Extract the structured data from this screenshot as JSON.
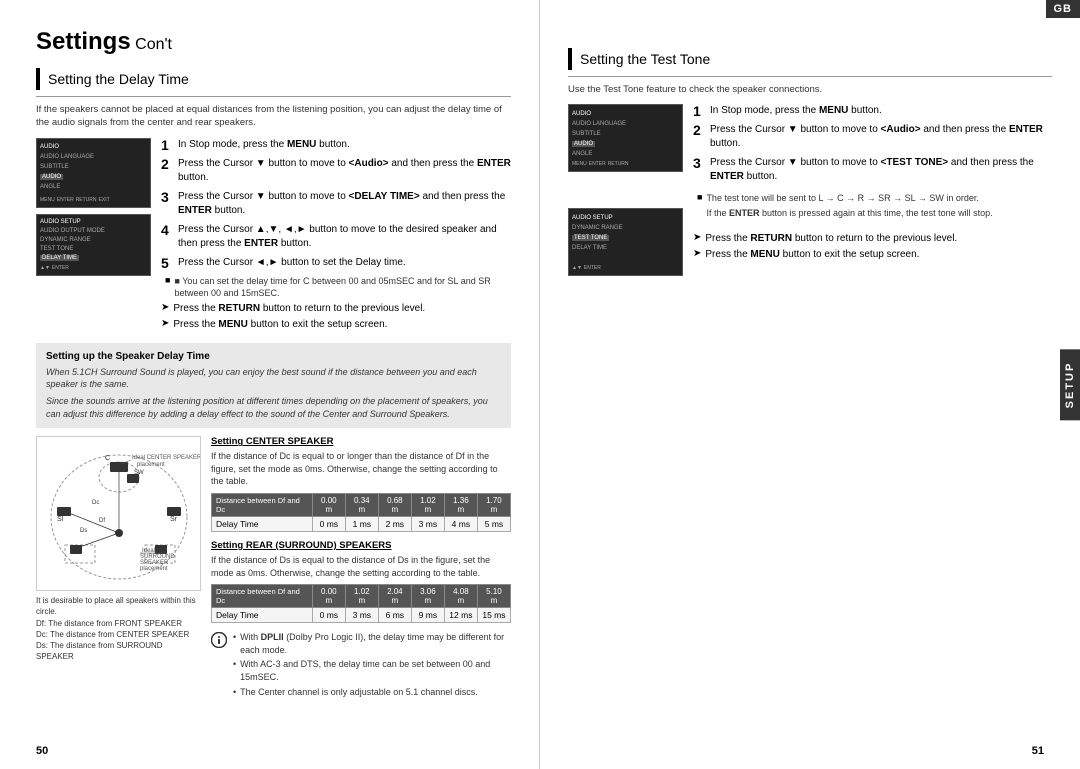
{
  "left": {
    "title": "Settings",
    "title_suffix": " Con't",
    "section1": {
      "heading": "Setting the Delay Time",
      "intro": "If the speakers cannot be placed at equal distances from the listening position, you can adjust the delay time of the audio signals from the center and rear speakers.",
      "steps": [
        {
          "num": "1",
          "text": "In Stop mode, press the MENU button."
        },
        {
          "num": "2",
          "text": "Press the Cursor ▼ button to move to <Audio> and then press the ENTER button."
        },
        {
          "num": "3",
          "text": "Press the Cursor ▼ button to move to <DELAY TIME> and then press the ENTER button."
        },
        {
          "num": "4",
          "text": "Press the Cursor ▲,▼, ◄,► button to move to the desired speaker and then press the ENTER button."
        },
        {
          "num": "5",
          "text": "Press the Cursor ◄,► button to set the Delay time."
        }
      ],
      "note": "■ You can set the delay time for C between 00 and 05mSEC and for SL and SR between 00 and 15mSEC.",
      "return_text": "Press the RETURN button to return to the previous level.",
      "menu_text": "Press the MENU button to exit the setup screen."
    },
    "infobox": {
      "title": "Setting up the Speaker Delay Time",
      "text1": "When 5.1CH Surround Sound is played, you can enjoy the best sound if the distance between you and each speaker is the same.",
      "text2": "Since the sounds arrive at the listening position at different times depending on the placement of speakers, you can adjust this difference by adding a delay effect to the sound of the Center and Surround Speakers."
    },
    "center_speaker": {
      "title": "Setting CENTER SPEAKER",
      "text": "If the distance of Dc is equal to or longer than the distance of Df in the figure, set the mode as 0ms. Otherwise, change the setting according to the table."
    },
    "center_table": {
      "header_row": [
        "Distance between Df and Dc",
        "0.00 m",
        "0.34 m",
        "0.68 m",
        "1.02 m",
        "1.36 m",
        "1.70 m"
      ],
      "data_row": [
        "Delay Time",
        "0 ms",
        "1 ms",
        "2 ms",
        "3 ms",
        "4 ms",
        "5 ms"
      ]
    },
    "rear_speaker": {
      "title": "Setting REAR (SURROUND) SPEAKERS",
      "text": "If the distance of Ds is equal to the distance of Ds in the figure, set the mode as 0ms. Otherwise, change the setting according to the table."
    },
    "rear_table": {
      "header_row": [
        "Distance between Df and Dc",
        "0.00 m",
        "1.02 m",
        "2.04 m",
        "3.06 m",
        "4.08 m",
        "5.10 m"
      ],
      "data_row": [
        "Delay Time",
        "0 ms",
        "3 ms",
        "6 ms",
        "9 ms",
        "12 ms",
        "15 ms"
      ]
    },
    "notes_icon": {
      "bullets": [
        "With DPLII (Dolby Pro Logic II), the delay time may be different for each mode.",
        "With AC-3 and DTS, the delay time can be set between 00 and 15mSEC.",
        "The Center channel is only adjustable on 5.1 channel discs."
      ]
    },
    "diagram_caption": "It is desirable to place all speakers within this circle.\nDf: The distance from FRONT SPEAKER\nDc: The distance from CENTER SPEAKER\nDs: The distance from SURROUND SPEAKER",
    "diagram_labels": {
      "ideal_center": "Ideal CENTER SPEAKER placement",
      "ideal_surround": "Ideal SURROUND SPEAKER placement",
      "c_label": "C",
      "sw_label": "SW",
      "dc_label": "Dc",
      "df_label": "Df",
      "ds_label": "Ds",
      "sl_label": "Sl",
      "sr_label": "Sr"
    },
    "page_number": "50"
  },
  "right": {
    "section2": {
      "heading": "Setting the Test Tone",
      "intro": "Use the Test Tone feature to check the speaker connections.",
      "steps": [
        {
          "num": "1",
          "text": "In Stop mode, press the MENU button."
        },
        {
          "num": "2",
          "text": "Press the Cursor ▼ button to move to <Audio> and then press the ENTER button."
        },
        {
          "num": "3",
          "text": "Press the Cursor ▼ button to move to <TEST TONE> and then press the ENTER button."
        }
      ],
      "note_bullet": "■ The test tone will be sent to L → C → R → SR → SL → SW in order.\n   If the ENTER button is pressed again at this time, the test tone will stop.",
      "return_text": "Press the RETURN button to return to the previous level.",
      "menu_text": "Press the MENU button to exit the setup screen."
    },
    "gb_badge": "GB",
    "setup_badge": "SETUP",
    "page_number": "51"
  }
}
